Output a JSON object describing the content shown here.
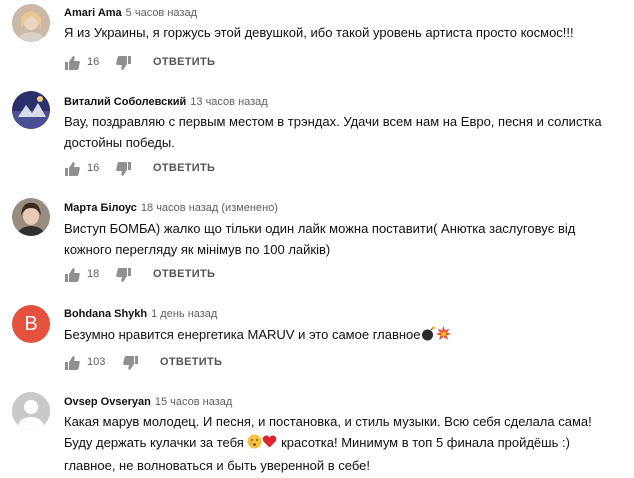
{
  "comments": [
    {
      "author": "Amari Ama",
      "time": "5 часов назад",
      "text": "Я из Украины, я горжусь этой девушкой, ибо такой уровень артиста просто космос!!!",
      "likes": "16",
      "reply": "ОТВЕТИТЬ",
      "avatar": "photo-avatar-blonde"
    },
    {
      "author": "Виталий Соболевский",
      "time": "13 часов назад",
      "text": "Вау, поздравляю с первым местом в трэндах. Удачи всем нам на Евро, песня и солистка достойны победы.",
      "likes": "16",
      "reply": "ОТВЕТИТЬ",
      "avatar": "photo-avatar-landscape"
    },
    {
      "author": "Марта Білоус",
      "time": "18 часов назад (изменено)",
      "text": "Виступ БОМБА) жалко що тільки один лайк можна поставити( Анютка заслуговує від кожного перегляду як мінімув по 100 лайків)",
      "likes": "18",
      "reply": "ОТВЕТИТЬ",
      "avatar": "photo-avatar-woman"
    },
    {
      "author": "Bohdana Shykh",
      "time": "1 день назад",
      "text": "Безумно нравится енергетика MARUV и это самое главное",
      "emoji": [
        "bomb-emoji",
        "collision-emoji"
      ],
      "likes": "103",
      "reply": "ОТВЕТИТЬ",
      "avatar_letter": "B",
      "avatar_color": "#e5503f"
    },
    {
      "author": "Ovsep Ovseryan",
      "time": "15 часов назад",
      "text_lines": [
        "Какая марув молодец. И песня, и постановка, и стиль музыки. Всю себя сделала сама!",
        "Буду держать кулачки за тебя",
        "красотка! Минимум в топ 5 финала пройдёшь :)",
        "главное, не волноваться и быть уверенной в себе!"
      ],
      "avatar": "default-user-avatar"
    }
  ]
}
